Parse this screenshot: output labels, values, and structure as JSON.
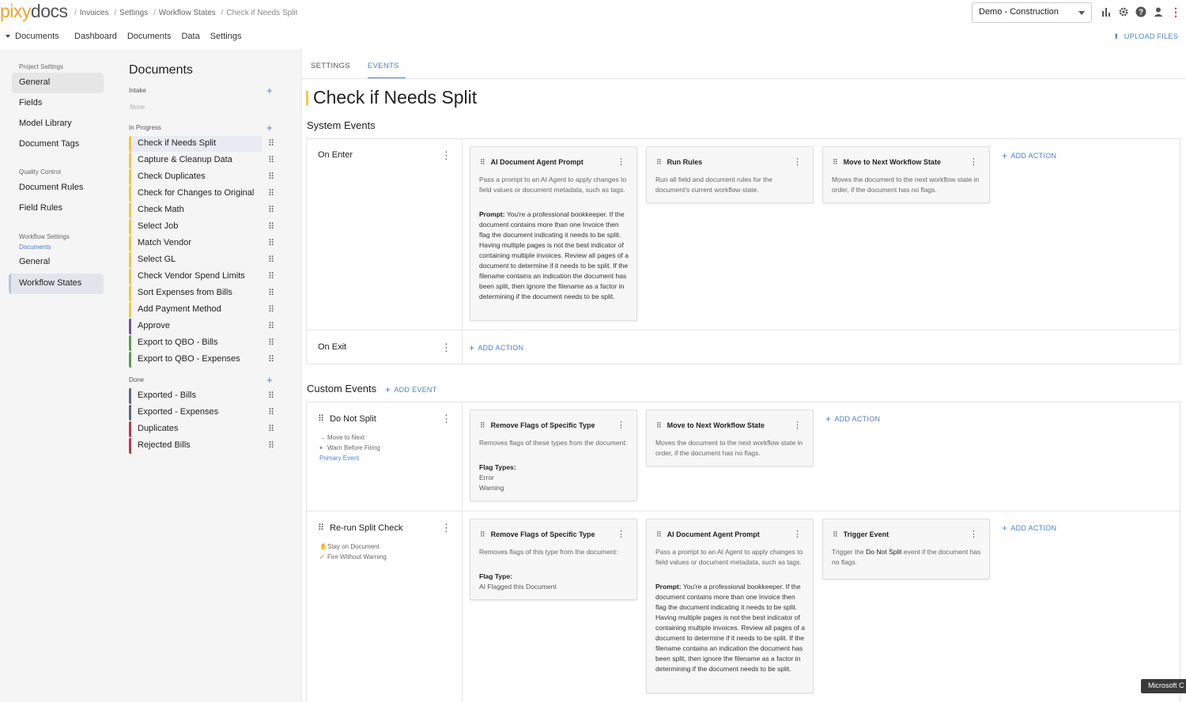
{
  "header": {
    "logo_a": "pixy",
    "logo_b": "docs",
    "breadcrumbs": [
      "Invoices",
      "Settings",
      "Workflow States",
      "Check if Needs Split"
    ],
    "project": "Demo - Construction",
    "icons": [
      "bar-chart-icon",
      "gear-icon",
      "help-icon",
      "user-icon",
      "more-vertical-icon"
    ]
  },
  "nav": {
    "documents_menu": "Documents",
    "links": [
      "Dashboard",
      "Documents",
      "Data",
      "Settings"
    ],
    "upload": "UPLOAD FILES"
  },
  "sidebar": {
    "project_settings": "Project Settings",
    "project_items": [
      "General",
      "Fields",
      "Model Library",
      "Document Tags"
    ],
    "quality_control": "Quality Control",
    "qc_items": [
      "Document Rules",
      "Field Rules"
    ],
    "workflow_settings": "Workflow Settings",
    "workflow_sub": "Documents",
    "workflow_items": [
      "General",
      "Workflow States"
    ]
  },
  "states": {
    "title": "Documents",
    "intake_label": "Intake",
    "intake_none": "None",
    "in_progress_label": "In Progress",
    "in_progress": [
      {
        "label": "Check if Needs Split",
        "color": "#f2c744"
      },
      {
        "label": "Capture & Cleanup Data",
        "color": "#f2c744"
      },
      {
        "label": "Check Duplicates",
        "color": "#f2c744"
      },
      {
        "label": "Check for Changes to Original",
        "color": "#f2c744"
      },
      {
        "label": "Check Math",
        "color": "#f2c744"
      },
      {
        "label": "Select Job",
        "color": "#f2c744"
      },
      {
        "label": "Match Vendor",
        "color": "#f2c744"
      },
      {
        "label": "Select GL",
        "color": "#f2c744"
      },
      {
        "label": "Check Vendor Spend Limits",
        "color": "#f2c744"
      },
      {
        "label": "Sort Expenses from Bills",
        "color": "#f2c744"
      },
      {
        "label": "Add Payment Method",
        "color": "#f2c744"
      },
      {
        "label": "Approve",
        "color": "#7b4fa0"
      },
      {
        "label": "Export to QBO - Bills",
        "color": "#5a9e4a"
      },
      {
        "label": "Export to QBO - Expenses",
        "color": "#5a9e4a"
      }
    ],
    "done_label": "Done",
    "done": [
      {
        "label": "Exported - Bills",
        "color": "#5a6a80"
      },
      {
        "label": "Exported - Expenses",
        "color": "#5a6a80"
      },
      {
        "label": "Duplicates",
        "color": "#c0354a"
      },
      {
        "label": "Rejected Bills",
        "color": "#c0354a"
      }
    ]
  },
  "tabs": [
    "SETTINGS",
    "EVENTS"
  ],
  "main": {
    "title": "Check if Needs Split",
    "system_events": "System Events",
    "custom_events": "Custom Events",
    "add_event": "ADD EVENT",
    "add_action": "ADD ACTION",
    "on_enter": "On Enter",
    "on_exit": "On Exit",
    "prompt_text": "You're a professional bookkeeper. If the document contains more than one Invoice then flag the document indicating it needs to be split. Having multiple pages is not the best indicator of containing multiple invoices. Review all pages of a document to determine if it needs to be split. If the filename contains an indication the document has been split, then ignore the filename as a factor in determining if the document needs to be split.",
    "prompt_label": "Prompt:",
    "ai_title": "AI Document Agent Prompt",
    "ai_desc": "Pass a prompt to an AI Agent to apply changes to field values or document metadata, such as tags.",
    "run_rules_title": "Run Rules",
    "run_rules_desc": "Run all field and document rules for the document's current workflow state.",
    "move_title": "Move to Next Workflow State",
    "move_desc": "Moves the document to the next workflow state in order, if the document has no flags.",
    "remove_title": "Remove Flags of Specific Type",
    "remove_desc_plural": "Removes flags of these types from the document:",
    "remove_desc_single": "Removes flags of this type from the document:",
    "flag_types_label": "Flag Types:",
    "flag_types": [
      "Error",
      "Warning"
    ],
    "flag_type_label": "Flag Type:",
    "flag_type_value": "AI Flagged this Document",
    "trigger_title": "Trigger Event",
    "trigger_desc_a": "Trigger the",
    "trigger_desc_event": "Do Not Split",
    "trigger_desc_b": "event if the document has no flags.",
    "custom": [
      {
        "name": "Do Not Split",
        "meta": [
          "Move to Next",
          "Warn Before Firing"
        ],
        "primary": "Primary Event"
      },
      {
        "name": "Re-run Split Check",
        "meta": [
          "Stay on Document",
          "Fire Without Warning"
        ]
      }
    ]
  },
  "toast": "Microsoft C"
}
